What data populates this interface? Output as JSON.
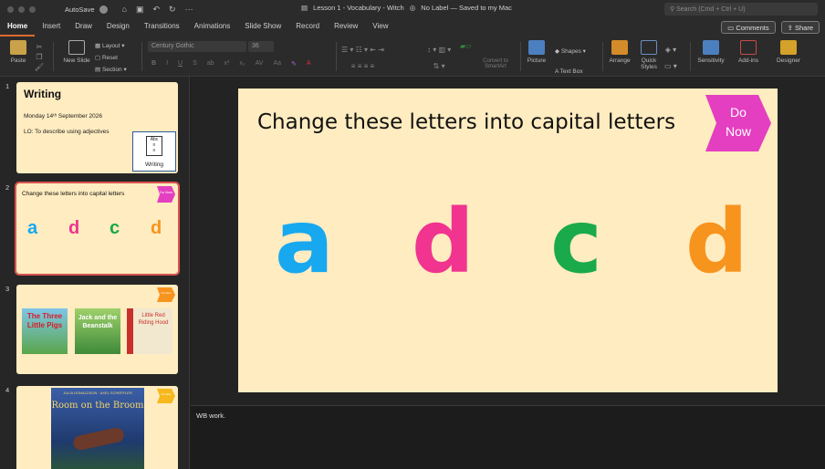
{
  "titlebar": {
    "autosave_label": "AutoSave",
    "doc_title": "Lesson 1 - Vocabulary - Witch",
    "label_status": "No Label — Saved to my Mac",
    "search_placeholder": "Search (Cmd + Ctrl + U)"
  },
  "tabs": [
    "Home",
    "Insert",
    "Draw",
    "Design",
    "Transitions",
    "Animations",
    "Slide Show",
    "Record",
    "Review",
    "View"
  ],
  "tab_buttons": {
    "comments": "Comments",
    "share": "Share"
  },
  "ribbon": {
    "paste": "Paste",
    "new_slide": "New Slide",
    "layout": "Layout",
    "reset": "Reset",
    "section": "Section",
    "font_name": "Century Gothic",
    "font_size": "36",
    "fmt_buttons": [
      "B",
      "I",
      "U",
      "S",
      "ab",
      "x²",
      "x₂",
      "AV",
      "Aa"
    ],
    "convert_smartart": "Convert to SmartArt",
    "picture": "Picture",
    "shapes": "Shapes",
    "text_box": "Text Box",
    "arrange": "Arrange",
    "quick_styles": "Quick Styles",
    "sensitivity": "Sensitivity",
    "add_ins": "Add-ins",
    "designer": "Designer"
  },
  "thumbnails": [
    {
      "number": "1",
      "title": "Writing",
      "date": "Monday 14ᵗʰ September 2026",
      "lo": "LO: To describe using adjectives",
      "card_label": "Writing"
    },
    {
      "number": "2",
      "title": "Change these letters into capital letters",
      "badge": "Do Now",
      "letters": [
        "a",
        "d",
        "c",
        "d"
      ]
    },
    {
      "number": "3",
      "books": [
        "The Three Little Pigs",
        "Jack and the Beanstalk",
        "Little Red Riding Hood"
      ],
      "badge": "Do Now"
    },
    {
      "number": "4",
      "book": "Room on the Broom",
      "book_header": "JULIA DONALDSON · AXEL SCHEFFLER",
      "badge": "Do Now"
    }
  ],
  "slide": {
    "title": "Change these letters into capital letters",
    "badge_line1": "Do",
    "badge_line2": "Now",
    "letters": [
      {
        "char": "a",
        "color": "#17a8f0"
      },
      {
        "char": "d",
        "color": "#f0348f"
      },
      {
        "char": "c",
        "color": "#1aa94b"
      },
      {
        "char": "d",
        "color": "#f7941d"
      }
    ]
  },
  "notes": {
    "text": "WB work."
  },
  "colors": {
    "accent": "#e06a2e",
    "badge": "#e43fc0",
    "selected_outline": "#d9534f",
    "slide_bg": "#ffecc0"
  }
}
